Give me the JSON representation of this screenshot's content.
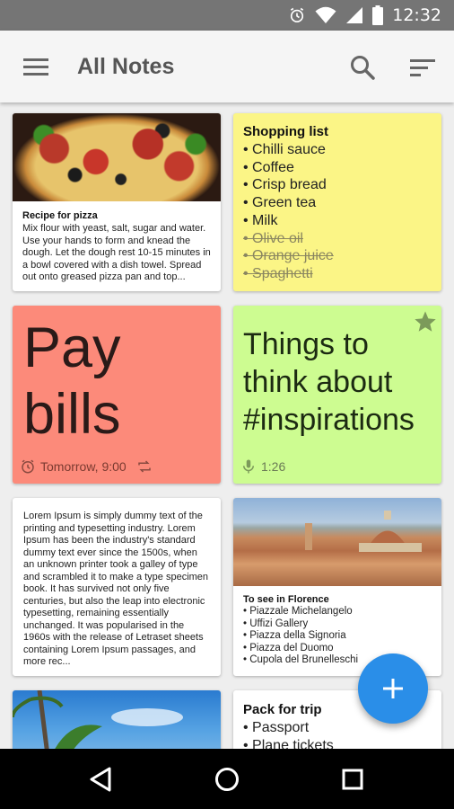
{
  "status_bar": {
    "time": "12:32"
  },
  "app_bar": {
    "title": "All Notes"
  },
  "notes": {
    "pizza": {
      "title": "Recipe for pizza",
      "body": "Mix flour with yeast, salt, sugar and water. Use your hands to form and knead the dough. Let the dough rest 10-15 minutes in a bowl covered with a dish towel. Spread out onto greased pizza pan and top..."
    },
    "shopping": {
      "title": "Shopping list",
      "items": [
        {
          "text": "Chilli sauce",
          "done": false
        },
        {
          "text": "Coffee",
          "done": false
        },
        {
          "text": "Crisp bread",
          "done": false
        },
        {
          "text": "Green tea",
          "done": false
        },
        {
          "text": "Milk",
          "done": false
        },
        {
          "text": "Olive oil",
          "done": true
        },
        {
          "text": "Orange juice",
          "done": true
        },
        {
          "text": "Spaghetti",
          "done": true
        }
      ]
    },
    "pay_bills": {
      "line1": "Pay",
      "line2": "bills",
      "reminder": "Tomorrow, 9:00"
    },
    "inspirations": {
      "line1": "Things to",
      "line2": "think about",
      "line3": "#inspirations",
      "audio_length": "1:26"
    },
    "lorem": {
      "body": "Lorem Ipsum is simply dummy text of the printing and typesetting industry. Lorem Ipsum has been the industry's standard dummy text ever since the 1500s, when an unknown printer took a galley of type and scrambled it to make a type specimen book. It has survived not only five centuries, but also the leap into electronic typesetting, remaining essentially unchanged. It was popularised in the 1960s with the release of Letraset sheets containing Lorem Ipsum passages, and more rec..."
    },
    "florence": {
      "title": "To see in Florence",
      "items": [
        "Piazzale Michelangelo",
        "Uffizi Gallery",
        "Piazza della Signoria",
        "Piazza del Duomo",
        "Cupola del Brunelleschi"
      ]
    },
    "trip": {
      "title": "Pack for trip",
      "items": [
        "Passport",
        "Plane tickets"
      ]
    }
  },
  "colors": {
    "yellow_note": "#fbf586",
    "red_note": "#fc8a7a",
    "green_note": "#cdfc91",
    "fab": "#2a8ee8"
  }
}
